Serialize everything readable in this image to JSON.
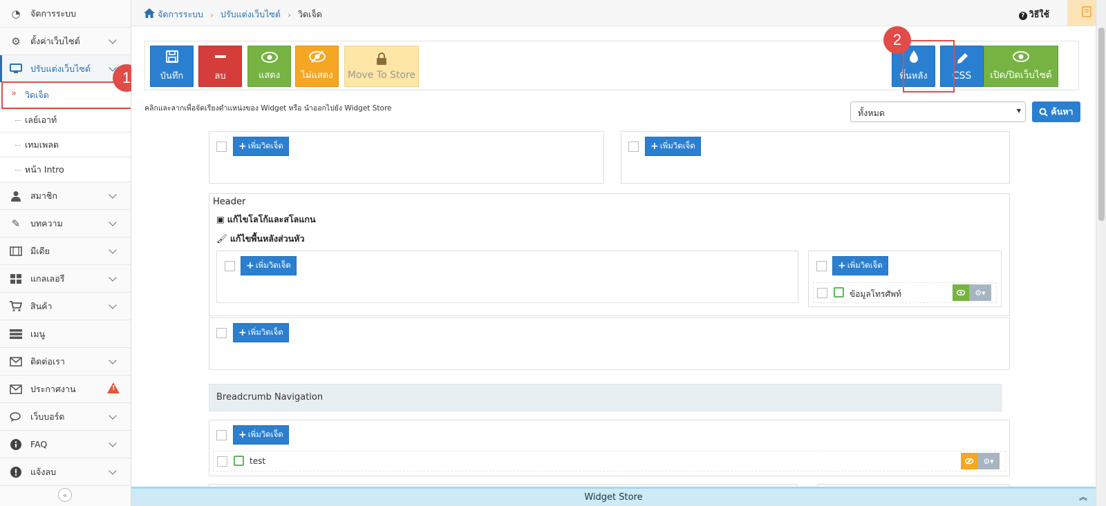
{
  "sidebar": {
    "items": [
      {
        "label": "จัดการระบบ",
        "icon": "dashboard-icon"
      },
      {
        "label": "ตั้งค่าเว็บไซต์",
        "icon": "gear-icon"
      },
      {
        "label": "ปรับแต่งเว็บไซต์",
        "icon": "monitor-icon"
      },
      {
        "label": "สมาชิก",
        "icon": "user-icon"
      },
      {
        "label": "บทความ",
        "icon": "edit-icon"
      },
      {
        "label": "มีเดีย",
        "icon": "film-icon"
      },
      {
        "label": "แกลเลอรี",
        "icon": "grid-icon"
      },
      {
        "label": "สินค้า",
        "icon": "cart-icon"
      },
      {
        "label": "เมนู",
        "icon": "menu-icon"
      },
      {
        "label": "ติดต่อเรา",
        "icon": "envelope-icon"
      },
      {
        "label": "ประกาศงาน",
        "icon": "envelope-icon"
      },
      {
        "label": "เว็บบอร์ด",
        "icon": "chat-icon"
      },
      {
        "label": "FAQ",
        "icon": "info-icon"
      },
      {
        "label": "แจ้งลบ",
        "icon": "exclamation-icon"
      }
    ],
    "subitems": [
      {
        "label": "วิดเจ็ด"
      },
      {
        "label": "เลย์เอาท์"
      },
      {
        "label": "เทมเพลต"
      },
      {
        "label": "หน้า Intro"
      }
    ]
  },
  "breadcrumb": {
    "home": "จัดการระบบ",
    "section": "ปรับแต่งเว็บไซต์",
    "current": "วิดเจ็ด"
  },
  "help_label": "วิธีใช้",
  "toolbar": {
    "save": "บันทึก",
    "delete": "ลบ",
    "show": "แสดง",
    "hide": "ไม่แสดง",
    "move_to_store": "Move To Store",
    "background": "พื้นหลัง",
    "css": "CSS",
    "toggle_site": "เปิด/ปิดเว็บไซต์"
  },
  "callouts": {
    "one": "1",
    "two": "2"
  },
  "hint": "คลิกและลากเพื่อจัดเรียงตำแหน่งของ Widget หรือ นำออกไปยัง Widget Store",
  "filter": {
    "selected": "ทั้งหมด",
    "search_label": "ค้นหา"
  },
  "add_widget_label": "เพิ่มวิดเจ็ด",
  "header_panel": {
    "title": "Header",
    "edit_logo": "แก้ไขโลโก้และสโลแกน",
    "edit_bg": "แก้ไขพื้นหลังส่วนหัว"
  },
  "widgets": {
    "phone": "ข้อมูลโทรศัพท์",
    "test": "test"
  },
  "breadcrumb_section": "Breadcrumb Navigation",
  "widget_store": "Widget Store",
  "colors": {
    "primary": "#2a7fd0",
    "danger": "#d43d3a",
    "success": "#76b343",
    "warning": "#f5a623",
    "callout": "#e34b48"
  }
}
